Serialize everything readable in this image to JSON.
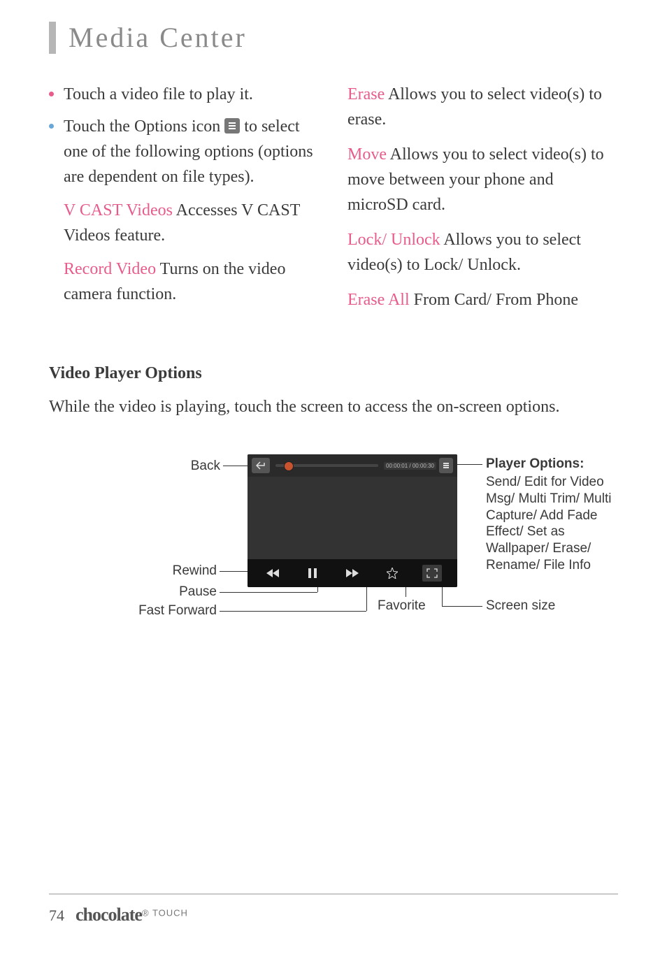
{
  "page_title": "Media Center",
  "left_col": {
    "item1": "Touch a video file to play it.",
    "item2_pre": "Touch the Options icon ",
    "item2_post": " to select one of the following options (options are dependent on file types).",
    "sub1_label": "V CAST Videos",
    "sub1_text": "  Accesses V CAST Videos feature.",
    "sub2_label": "Record Video",
    "sub2_text": "  Turns on the video camera function."
  },
  "right_col": {
    "r1_label": "Erase",
    "r1_text": "  Allows you to select video(s) to erase.",
    "r2_label": "Move",
    "r2_text": "  Allows you to select video(s) to move between your phone and microSD card.",
    "r3_label": "Lock/ Unlock",
    "r3_text": "  Allows you to select video(s) to Lock/ Unlock.",
    "r4_label": "Erase All",
    "r4_text": "  From Card/ From Phone"
  },
  "section": {
    "heading": "Video Player Options",
    "body": "While the video is playing, touch the screen to access the on-screen options."
  },
  "diagram": {
    "back": "Back",
    "rewind": "Rewind",
    "pause": "Pause",
    "ff": "Fast Forward",
    "favorite": "Favorite",
    "player_options_head": "Player Options:",
    "player_options_body": "Send/ Edit for Video Msg/ Multi Trim/ Multi Capture/ Add Fade Effect/ Set as Wallpaper/ Erase/ Rename/ File Info",
    "screen_size": "Screen size",
    "timecode": "00:00:01 / 00:00:30"
  },
  "footer": {
    "pagenum": "74",
    "brand": "chocolate",
    "brand_sub": "TOUCH"
  }
}
